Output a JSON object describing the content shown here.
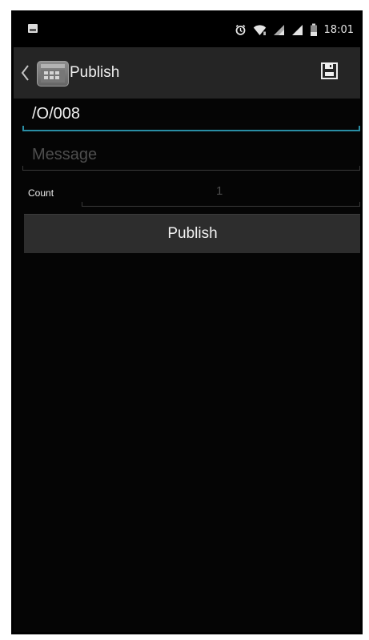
{
  "status_bar": {
    "time": "18:01",
    "left_icon": "gallery-notification-icon",
    "icons": [
      "alarm-icon",
      "wifi-icon",
      "cell-signal-icon",
      "cell-signal-icon",
      "battery-icon"
    ]
  },
  "app_bar": {
    "title": "Publish",
    "back_icon": "chevron-left-icon",
    "app_icon": "app-icon",
    "save_icon": "save-icon"
  },
  "form": {
    "topic_value": "/O/008",
    "message_placeholder": "Message",
    "count_label": "Count",
    "count_value": "1",
    "publish_label": "Publish"
  },
  "colors": {
    "background": "#050505",
    "app_bar": "#252525",
    "accent_underline": "#2a8ea5",
    "button": "#2d2d2d",
    "text": "#efefef",
    "hint": "#4e4e4e"
  }
}
